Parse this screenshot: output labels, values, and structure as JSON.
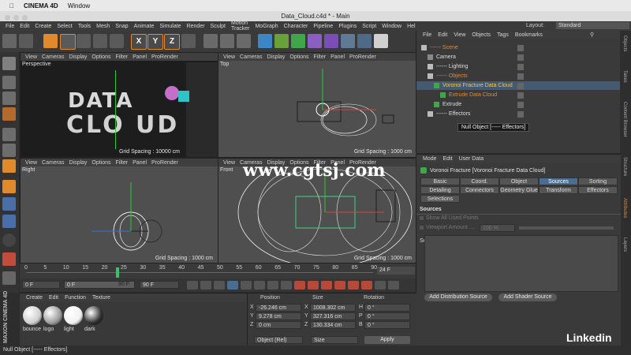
{
  "app": {
    "mac_menu": [
      "CINEMA 4D",
      "Window"
    ],
    "window_title": "Data_Cloud.c4d * - Main"
  },
  "menubar": [
    "File",
    "Edit",
    "Create",
    "Select",
    "Tools",
    "Mesh",
    "Snap",
    "Animate",
    "Simulate",
    "Render",
    "Sculpt",
    "Motion Tracker",
    "MoGraph",
    "Character",
    "Pipeline",
    "Plugins",
    "Script",
    "Window",
    "Help"
  ],
  "layout": {
    "label": "Layout:",
    "value": "Standard"
  },
  "toolbar": {
    "axis_x": "X",
    "axis_y": "Y",
    "axis_z": "Z"
  },
  "viewports": {
    "menu": [
      "View",
      "Cameras",
      "Display",
      "Options",
      "Filter",
      "Panel",
      "ProRender"
    ],
    "perspective": {
      "label": "Perspective",
      "grid": "Grid Spacing : 10000 cm",
      "text_line1": "DATA",
      "text_line2": "CLO UD"
    },
    "top": {
      "label": "Top",
      "grid": "Grid Spacing : 1000 cm"
    },
    "right": {
      "label": "Right",
      "grid": "Grid Spacing : 1000 cm"
    },
    "front": {
      "label": "Front",
      "grid": "Grid Spacing : 1000 cm"
    }
  },
  "watermark": "www.cgtsj.com",
  "objects_panel": {
    "menu": [
      "File",
      "Edit",
      "View",
      "Objects",
      "Tags",
      "Bookmarks"
    ],
    "items": [
      {
        "name": "------ Scene",
        "color": "#e4892f",
        "indent": 0
      },
      {
        "name": "Camera",
        "color": "#dddddd",
        "indent": 1
      },
      {
        "name": "------ Lighting",
        "color": "#dddddd",
        "indent": 1
      },
      {
        "name": "------ Objects",
        "color": "#e4892f",
        "indent": 1
      },
      {
        "name": "Voronoi Fracture Data Cloud",
        "color": "#f3c84b",
        "indent": 2
      },
      {
        "name": "Extrude Data Cloud",
        "color": "#e4892f",
        "indent": 3
      },
      {
        "name": "Extrude",
        "color": "#dddddd",
        "indent": 2
      },
      {
        "name": "------ Effectors",
        "color": "#dddddd",
        "indent": 1
      }
    ],
    "tooltip": "Null Object [----- Effectors]"
  },
  "right_sidetabs": [
    "Objects",
    "Takes",
    "Content Browser",
    "Structure",
    "Attributes",
    "Layers"
  ],
  "attributes": {
    "menu": [
      "Mode",
      "Edit",
      "User Data"
    ],
    "title": "Voronoi Fracture [Voronoi Fracture Data Cloud]",
    "tabs_row1": [
      "Basic",
      "Coord.",
      "Object",
      "Sources",
      "Sorting"
    ],
    "tabs_row2": [
      "Detailing",
      "Connectors",
      "Geometry Glue",
      "Transform",
      "Effectors"
    ],
    "tabs_row3": [
      "Selections"
    ],
    "section": "Sources",
    "show_all": "Show All Used Points",
    "viewport_amount_label": "Viewport Amount ....",
    "viewport_amount_value": "100 %",
    "sources_label": "Sources",
    "add_distribution": "Add Distribution Source",
    "add_shader": "Add Shader Source"
  },
  "timeline": {
    "ticks": [
      "0",
      "5",
      "10",
      "15",
      "20",
      "25",
      "30",
      "35",
      "40",
      "45",
      "50",
      "55",
      "60",
      "65",
      "70",
      "75",
      "80",
      "85",
      "90"
    ],
    "current_frame": "24 F",
    "start": "0 F",
    "range_start": "0 F",
    "range_end": "90 F",
    "end": "90 F"
  },
  "materials": {
    "menu": [
      "Create",
      "Edit",
      "Function",
      "Texture"
    ],
    "items": [
      {
        "name": "bounce",
        "color": "#cfcfcf"
      },
      {
        "name": "logo",
        "color": "#9a9a9a"
      },
      {
        "name": "light",
        "color": "#f1f1f1"
      },
      {
        "name": "dark",
        "color": "#2d2d2d"
      }
    ]
  },
  "coordinates": {
    "headers": [
      "Position",
      "Size",
      "Rotation"
    ],
    "rows": [
      {
        "axis": "X",
        "pos": "-26.246 cm",
        "saxis": "X",
        "size": "1008.302 cm",
        "raxis": "H",
        "rot": "0 °"
      },
      {
        "axis": "Y",
        "pos": "9.278 cm",
        "saxis": "Y",
        "size": "327.316 cm",
        "raxis": "P",
        "rot": "0 °"
      },
      {
        "axis": "Z",
        "pos": "0 cm",
        "saxis": "Z",
        "size": "130.334 cm",
        "raxis": "B",
        "rot": "0 °"
      }
    ],
    "mode": "Object (Rel)",
    "size_mode": "Size",
    "apply": "Apply"
  },
  "maxon": "MAXON CINEMA 4D",
  "status": "Null Object [----- Effectors]",
  "brand": "Linkedin"
}
